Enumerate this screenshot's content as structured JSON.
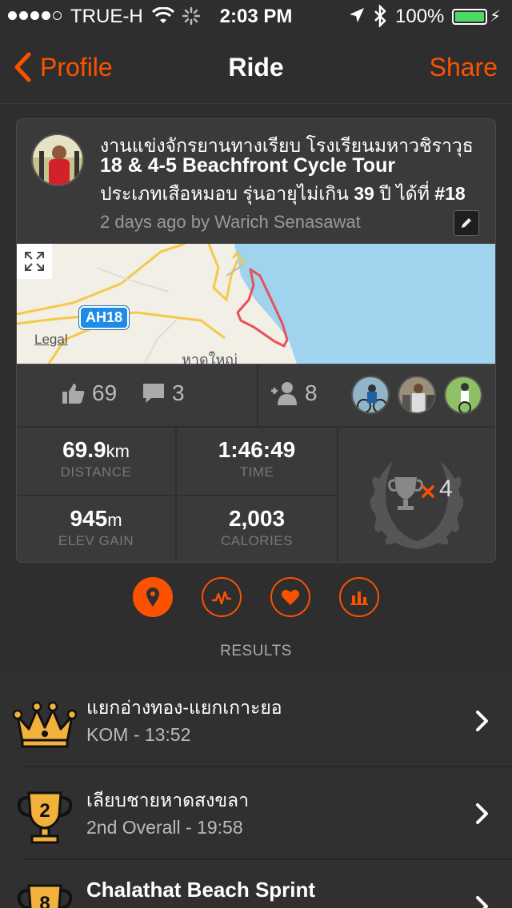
{
  "status": {
    "carrier": "TRUE-H",
    "time": "2:03 PM",
    "battery": "100%"
  },
  "nav": {
    "back_label": "Profile",
    "title": "Ride",
    "share_label": "Share"
  },
  "activity": {
    "title_line1": "งานแข่งจักรยานทางเรียบ โรงเรียนมหาวชิราวุธ",
    "title_line2": "18 & 4-5 Beachfront Cycle Tour",
    "title_line3_a": "ประเภทเสือหมอบ รุ่นอายุไม่เกิน",
    "title_line3_b": "39",
    "title_line3_c": "ปี ได้ที่",
    "title_line3_d": "#18",
    "subtitle": "2 days ago by Warich Senasawat"
  },
  "map": {
    "highway_label": "AH18",
    "legal_label": "Legal",
    "town_label": "หาดใหญ่"
  },
  "social": {
    "kudos_count": "69",
    "comment_count": "3",
    "group_count": "8"
  },
  "stats": {
    "distance_value": "69.9",
    "distance_unit": "km",
    "distance_label": "DISTANCE",
    "time_value": "1:46:49",
    "time_label": "TIME",
    "elev_value": "945",
    "elev_unit": "m",
    "elev_label": "ELEV GAIN",
    "calories_value": "2,003",
    "calories_label": "CALORIES",
    "trophy_count": "4"
  },
  "results_label": "RESULTS",
  "results": [
    {
      "name": "แยกอ่างทอง-แยกเกาะยอ",
      "meta": "KOM - 13:52",
      "icon": "crown-icon"
    },
    {
      "name": "เลียบชายหาดสงขลา",
      "meta": "2nd Overall - 19:58",
      "icon": "trophy-2-icon",
      "rank": "2"
    },
    {
      "name": "Chalathat Beach Sprint",
      "meta": "",
      "icon": "trophy-8-icon",
      "rank": "8"
    }
  ],
  "colors": {
    "accent": "#fc5200",
    "gold": "#f2b13a"
  }
}
